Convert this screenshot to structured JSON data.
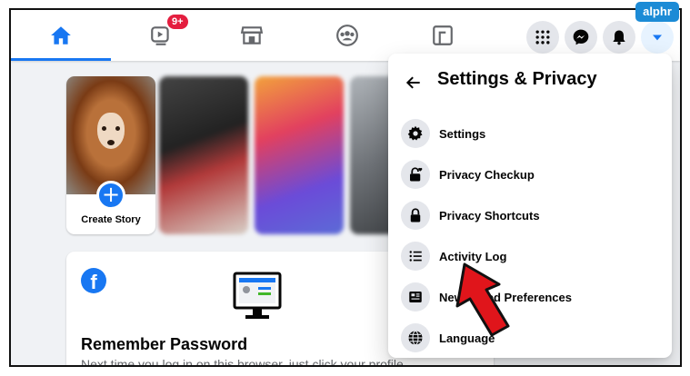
{
  "topbar": {
    "tabs": [
      {
        "name": "home",
        "active": true
      },
      {
        "name": "watch",
        "badge": "9+"
      },
      {
        "name": "marketplace"
      },
      {
        "name": "groups"
      },
      {
        "name": "gaming"
      }
    ],
    "buttons": [
      "menu-grid",
      "messenger",
      "notifications",
      "account-dropdown"
    ]
  },
  "stories": {
    "create_label": "Create Story"
  },
  "remember_card": {
    "title": "Remember Password",
    "text": "Next time you log in on this browser, just click your profile"
  },
  "settings_menu": {
    "title": "Settings & Privacy",
    "items": [
      {
        "label": "Settings",
        "icon": "gear-icon"
      },
      {
        "label": "Privacy Checkup",
        "icon": "lock-heart-icon"
      },
      {
        "label": "Privacy Shortcuts",
        "icon": "lock-icon"
      },
      {
        "label": "Activity Log",
        "icon": "list-icon"
      },
      {
        "label": "News Feed Preferences",
        "icon": "feed-icon"
      },
      {
        "label": "Language",
        "icon": "globe-icon"
      }
    ]
  },
  "watermark": "alphr",
  "colors": {
    "brand": "#1877f2",
    "badge": "#e41e3f",
    "arrow": "#e0151b",
    "icon_bg": "#e4e6eb"
  }
}
